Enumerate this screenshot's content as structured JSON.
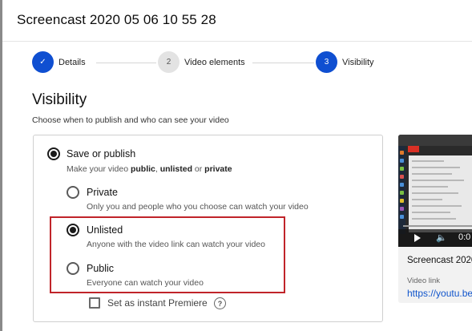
{
  "dialog": {
    "title": "Screencast 2020 05 06 10 55 28"
  },
  "stepper": {
    "steps": [
      {
        "indicator": "✓",
        "label": "Details",
        "state": "done"
      },
      {
        "indicator": "2",
        "label": "Video elements",
        "state": "inactive"
      },
      {
        "indicator": "3",
        "label": "Visibility",
        "state": "active"
      }
    ]
  },
  "visibility": {
    "title": "Visibility",
    "subtitle": "Choose when to publish and who can see your video",
    "save_or_publish": {
      "label": "Save or publish",
      "desc_prefix": "Make your video ",
      "desc_public": "public",
      "desc_sep1": ", ",
      "desc_unlisted": "unlisted",
      "desc_sep2": " or ",
      "desc_private": "private",
      "selected": true
    },
    "options": [
      {
        "label": "Private",
        "desc": "Only you and people who you choose can watch your video",
        "selected": false
      },
      {
        "label": "Unlisted",
        "desc": "Anyone with the video link can watch your video",
        "selected": true
      },
      {
        "label": "Public",
        "desc": "Everyone can watch your video",
        "selected": false
      }
    ],
    "premiere": {
      "label": "Set as instant Premiere",
      "checked": false,
      "help_glyph": "?"
    }
  },
  "preview": {
    "time": "0:0",
    "video_title": "Screencast 2020",
    "link_label": "Video link",
    "link_url": "https://youtu.be"
  },
  "colors": {
    "accent": "#0f4fd1",
    "highlight": "#c0242a",
    "link": "#1155cc"
  },
  "icons": [
    "check-icon",
    "play-icon",
    "volume-icon",
    "help-icon"
  ]
}
